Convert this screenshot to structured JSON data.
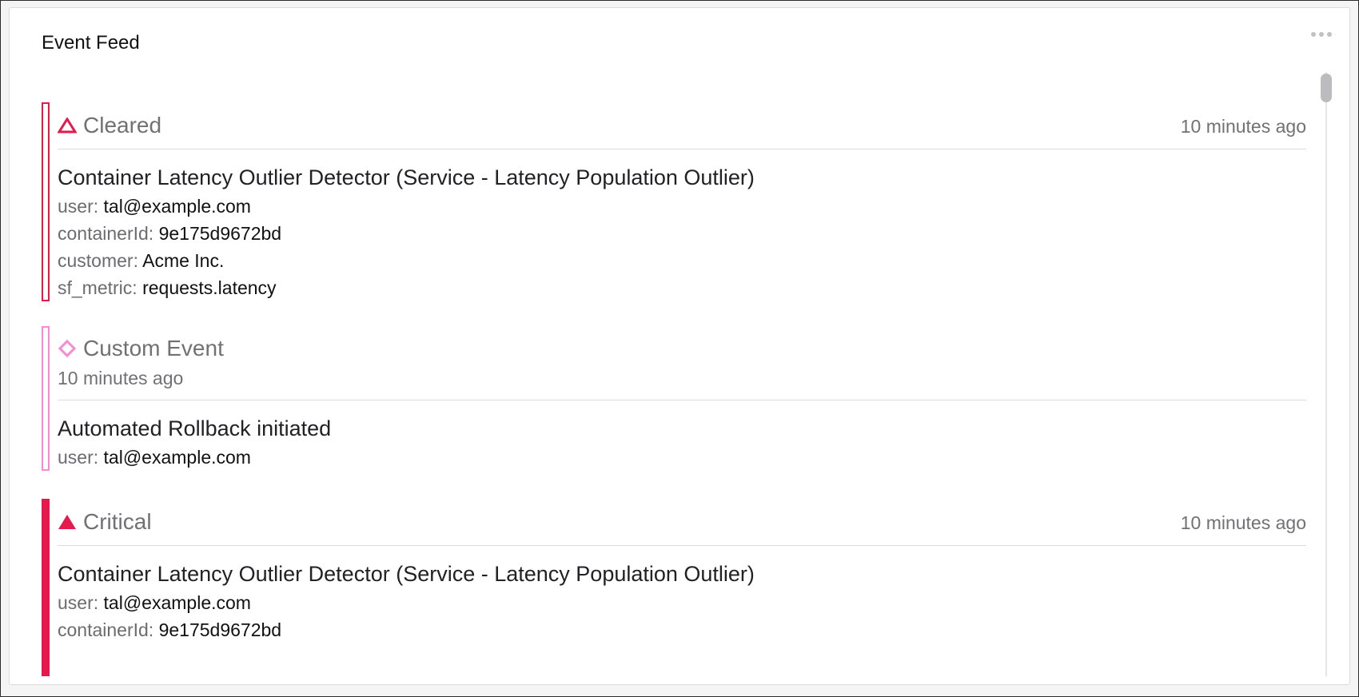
{
  "panel": {
    "title": "Event Feed",
    "menu_icon": "more-horizontal-icon"
  },
  "colors": {
    "critical": "#e5194b",
    "custom": "#f78ad2",
    "muted_text": "#717175"
  },
  "events": [
    {
      "type": "Cleared",
      "icon": "triangle-outline-icon",
      "time": "10 minutes ago",
      "title": "Container Latency Outlier Detector (Service - Latency Population Outlier)",
      "props": [
        {
          "key": "user:",
          "value": "tal@example.com"
        },
        {
          "key": "containerId:",
          "value": "9e175d9672bd"
        },
        {
          "key": "customer:",
          "value": "Acme Inc."
        },
        {
          "key": "sf_metric:",
          "value": "requests.latency"
        }
      ]
    },
    {
      "type": "Custom Event",
      "icon": "diamond-outline-icon",
      "time": "10 minutes ago",
      "title": "Automated Rollback initiated",
      "props": [
        {
          "key": "user:",
          "value": "tal@example.com"
        }
      ]
    },
    {
      "type": "Critical",
      "icon": "triangle-filled-icon",
      "time": "10 minutes ago",
      "title": "Container Latency Outlier Detector (Service - Latency Population Outlier)",
      "props": [
        {
          "key": "user:",
          "value": "tal@example.com"
        },
        {
          "key": "containerId:",
          "value": "9e175d9672bd"
        }
      ]
    }
  ]
}
